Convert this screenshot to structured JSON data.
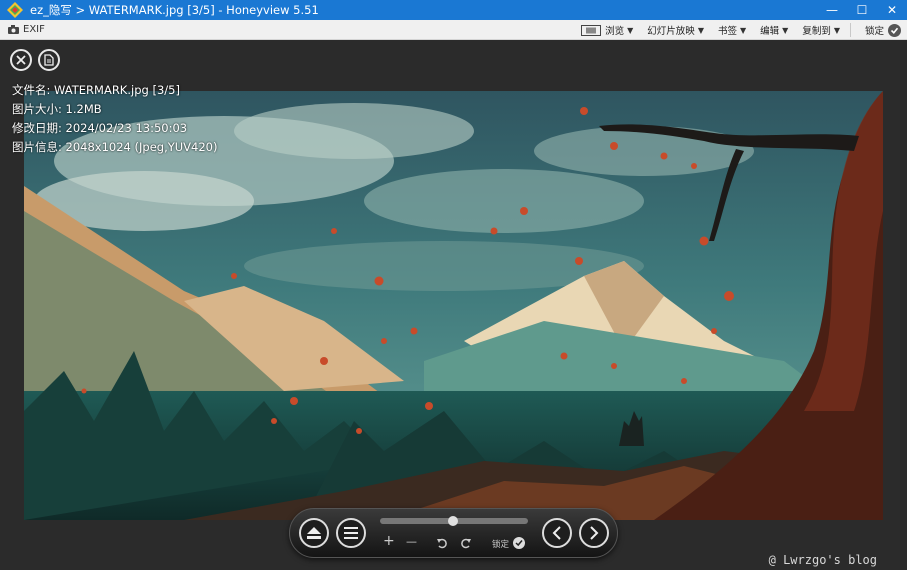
{
  "window": {
    "title": "ez_隐写 > WATERMARK.jpg [3/5] - Honeyview 5.51",
    "controls": {
      "minimize": "—",
      "maximize": "☐",
      "close": "✕"
    }
  },
  "toolbar": {
    "exif_label": "EXIF",
    "items": [
      {
        "label": "浏览"
      },
      {
        "label": "幻灯片放映"
      },
      {
        "label": "书签"
      },
      {
        "label": "编辑"
      },
      {
        "label": "复制到"
      }
    ],
    "lock_label": "锁定"
  },
  "info": {
    "filename": "文件名: WATERMARK.jpg [3/5]",
    "size": "图片大小: 1.2MB",
    "date": "修改日期: 2024/02/23 13:50:03",
    "details": "图片信息: 2048x1024 (Jpeg,YUV420)"
  },
  "controls": {
    "zoom_in": "+",
    "zoom_out": "—",
    "lock_label": "锁定",
    "slider_position": 0.49
  },
  "watermark_text": "@ Lwrzgo's blog"
}
